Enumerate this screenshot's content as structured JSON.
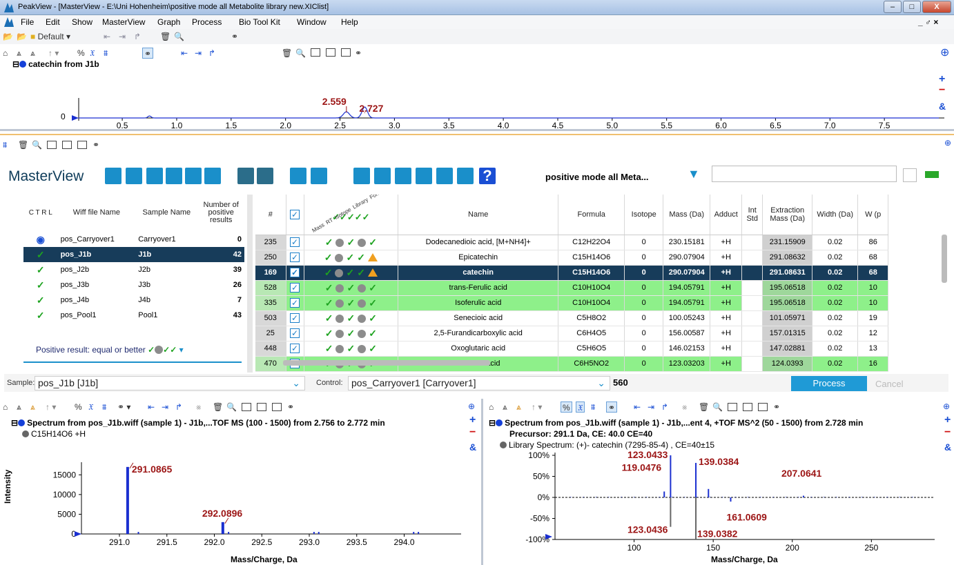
{
  "window": {
    "title": "PeakView - [MasterView - E:\\Uni Hohenheim\\positive mode all Metabolite library new.XIClist]",
    "min": "–",
    "max": "□",
    "close": "X"
  },
  "menu": {
    "items": [
      "File",
      "Edit",
      "Show",
      "MasterView",
      "Graph",
      "Process",
      "Bio Tool Kit",
      "Window",
      "Help"
    ],
    "right": "_ ♂ ×"
  },
  "toolbar1": {
    "default_label": "Default ▾"
  },
  "xic": {
    "title": "catechin from J1b",
    "peaks": [
      {
        "label": "2.559"
      },
      {
        "label": "2.727"
      }
    ],
    "y_tick": "0",
    "x_ticks": [
      "0.5",
      "1.0",
      "1.5",
      "2.0",
      "2.5",
      "3.0",
      "3.5",
      "4.0",
      "4.5",
      "5.0",
      "5.5",
      "6.0",
      "6.5",
      "7.0",
      "7.5"
    ],
    "peak_values": [
      2.559,
      2.727
    ],
    "x_range": [
      0.1,
      8.0
    ]
  },
  "masterview": {
    "title": "MasterView",
    "library_name": "positive mode all Meta...",
    "filter_value": "",
    "left_table": {
      "headers": [
        "C T R L",
        "Wiff file Name",
        "Sample Name",
        "Number of positive results"
      ],
      "rows": [
        {
          "ctrl": "◉",
          "wiff": "pos_Carryover1",
          "sample": "Carryover1",
          "count": "0"
        },
        {
          "ctrl": "✓",
          "wiff": "pos_J1b",
          "sample": "J1b",
          "count": "42"
        },
        {
          "ctrl": "✓",
          "wiff": "pos_J2b",
          "sample": "J2b",
          "count": "39"
        },
        {
          "ctrl": "✓",
          "wiff": "pos_J3b",
          "sample": "J3b",
          "count": "26"
        },
        {
          "ctrl": "✓",
          "wiff": "pos_J4b",
          "sample": "J4b",
          "count": "7"
        },
        {
          "ctrl": "✓",
          "wiff": "pos_Pool1",
          "sample": "Pool1",
          "count": "43"
        }
      ],
      "footer": "Positive result: equal or better"
    },
    "right_table": {
      "rotated_headers": [
        "Mass",
        "RT",
        "Isotope",
        "Library",
        "Formula"
      ],
      "headers": [
        "#",
        "✓",
        "",
        "Name",
        "Formula",
        "Isotope",
        "Mass (Da)",
        "Adduct",
        "Int Std",
        "Extraction Mass (Da)",
        "Width (Da)",
        "W (p"
      ],
      "rows": [
        {
          "n": "235",
          "name": "Dodecanedioic acid, [M+NH4]+",
          "formula": "C12H22O4",
          "iso": "0",
          "mass": "230.15181",
          "adduct": "+H",
          "ext": "231.15909",
          "width": "0.02",
          "w": "86",
          "icons": "ok,grey,ok,grey,ok",
          "style": ""
        },
        {
          "n": "250",
          "name": "Epicatechin",
          "formula": "C15H14O6",
          "iso": "0",
          "mass": "290.07904",
          "adduct": "+H",
          "ext": "291.08632",
          "width": "0.02",
          "w": "68",
          "icons": "ok,grey,ok,ok,tri",
          "style": ""
        },
        {
          "n": "169",
          "name": "catechin",
          "formula": "C15H14O6",
          "iso": "0",
          "mass": "290.07904",
          "adduct": "+H",
          "ext": "291.08631",
          "width": "0.02",
          "w": "68",
          "icons": "ok,grey,ok,ok,tri",
          "style": "sel"
        },
        {
          "n": "528",
          "name": "trans-Ferulic acid",
          "formula": "C10H10O4",
          "iso": "0",
          "mass": "194.05791",
          "adduct": "+H",
          "ext": "195.06518",
          "width": "0.02",
          "w": "10",
          "icons": "ok,grey,ok,grey,ok",
          "style": "green"
        },
        {
          "n": "335",
          "name": "Isoferulic acid",
          "formula": "C10H10O4",
          "iso": "0",
          "mass": "194.05791",
          "adduct": "+H",
          "ext": "195.06518",
          "width": "0.02",
          "w": "10",
          "icons": "ok,grey,ok,grey,ok",
          "style": "green"
        },
        {
          "n": "503",
          "name": "Senecioic acid",
          "formula": "C5H8O2",
          "iso": "0",
          "mass": "100.05243",
          "adduct": "+H",
          "ext": "101.05971",
          "width": "0.02",
          "w": "19",
          "icons": "ok,grey,ok,grey,ok",
          "style": ""
        },
        {
          "n": "25",
          "name": "2,5-Furandicarboxylic acid",
          "formula": "C6H4O5",
          "iso": "0",
          "mass": "156.00587",
          "adduct": "+H",
          "ext": "157.01315",
          "width": "0.02",
          "w": "12",
          "icons": "ok,grey,ok,grey,ok",
          "style": ""
        },
        {
          "n": "448",
          "name": "Oxoglutaric acid",
          "formula": "C5H6O5",
          "iso": "0",
          "mass": "146.02153",
          "adduct": "+H",
          "ext": "147.02881",
          "width": "0.02",
          "w": "13",
          "icons": "ok,grey,ok,grey,ok",
          "style": ""
        },
        {
          "n": "470",
          "name": "Picolinic acid",
          "formula": "C6H5NO2",
          "iso": "0",
          "mass": "123.03203",
          "adduct": "+H",
          "ext": "124.0393",
          "width": "0.02",
          "w": "16",
          "icons": "ok,grey,ok,grey,ok",
          "style": "green"
        }
      ]
    },
    "sample_label": "Sample:",
    "sample_value": "pos_J1b   [J1b]",
    "control_label": "Control:",
    "control_value": "pos_Carryover1   [Carryover1]",
    "count": "560",
    "process": "Process",
    "cancel": "Cancel"
  },
  "spectrum_left": {
    "title": "Spectrum from pos_J1b.wiff (sample 1) - J1b,...TOF MS (100 - 1500) from 2.756 to 2.772 min",
    "legend": "C15H14O6 +H",
    "ylabel": "Intensity",
    "xlabel": "Mass/Charge, Da",
    "y_ticks": [
      "15000",
      "10000",
      "5000",
      "0"
    ],
    "x_ticks": [
      "291.0",
      "291.5",
      "292.0",
      "292.5",
      "293.0",
      "293.5",
      "294.0"
    ],
    "peak_labels": [
      "291.0865",
      "292.0896"
    ],
    "peaks": [
      {
        "mz": 291.0865,
        "intensity": 17000
      },
      {
        "mz": 292.0896,
        "intensity": 3000
      }
    ],
    "x_range": [
      290.6,
      294.6
    ],
    "y_range": [
      0,
      17500
    ]
  },
  "spectrum_right": {
    "title": "Spectrum from pos_J1b.wiff (sample 1) - J1b,...ent 4, +TOF MS^2 (50 - 1500) from 2.728 min",
    "precursor": "Precursor: 291.1 Da, CE: 40.0 CE=40",
    "library": "Library Spectrum: (+)- catechin (7295-85-4) , CE=40±15",
    "xlabel": "Mass/Charge, Da",
    "y_ticks": [
      "100%",
      "50%",
      "0%",
      "-50%",
      "-100%"
    ],
    "x_ticks": [
      "100",
      "150",
      "200",
      "250"
    ],
    "peak_labels": [
      "123.0433",
      "119.0476",
      "139.0384",
      "207.0641",
      "161.0609",
      "139.0382",
      "123.0436"
    ],
    "peaks_top": [
      {
        "mz": 119.0476,
        "pct": 14
      },
      {
        "mz": 123.0433,
        "pct": 100
      },
      {
        "mz": 139.0384,
        "pct": 82
      },
      {
        "mz": 147.0,
        "pct": 20
      },
      {
        "mz": 161.0609,
        "pct": -10
      },
      {
        "mz": 207.0641,
        "pct": 4
      }
    ],
    "peaks_bottom": [
      {
        "mz": 123.0436,
        "pct": -70
      },
      {
        "mz": 139.0382,
        "pct": -100
      }
    ],
    "x_range": [
      50,
      290
    ],
    "y_range": [
      -100,
      100
    ]
  }
}
